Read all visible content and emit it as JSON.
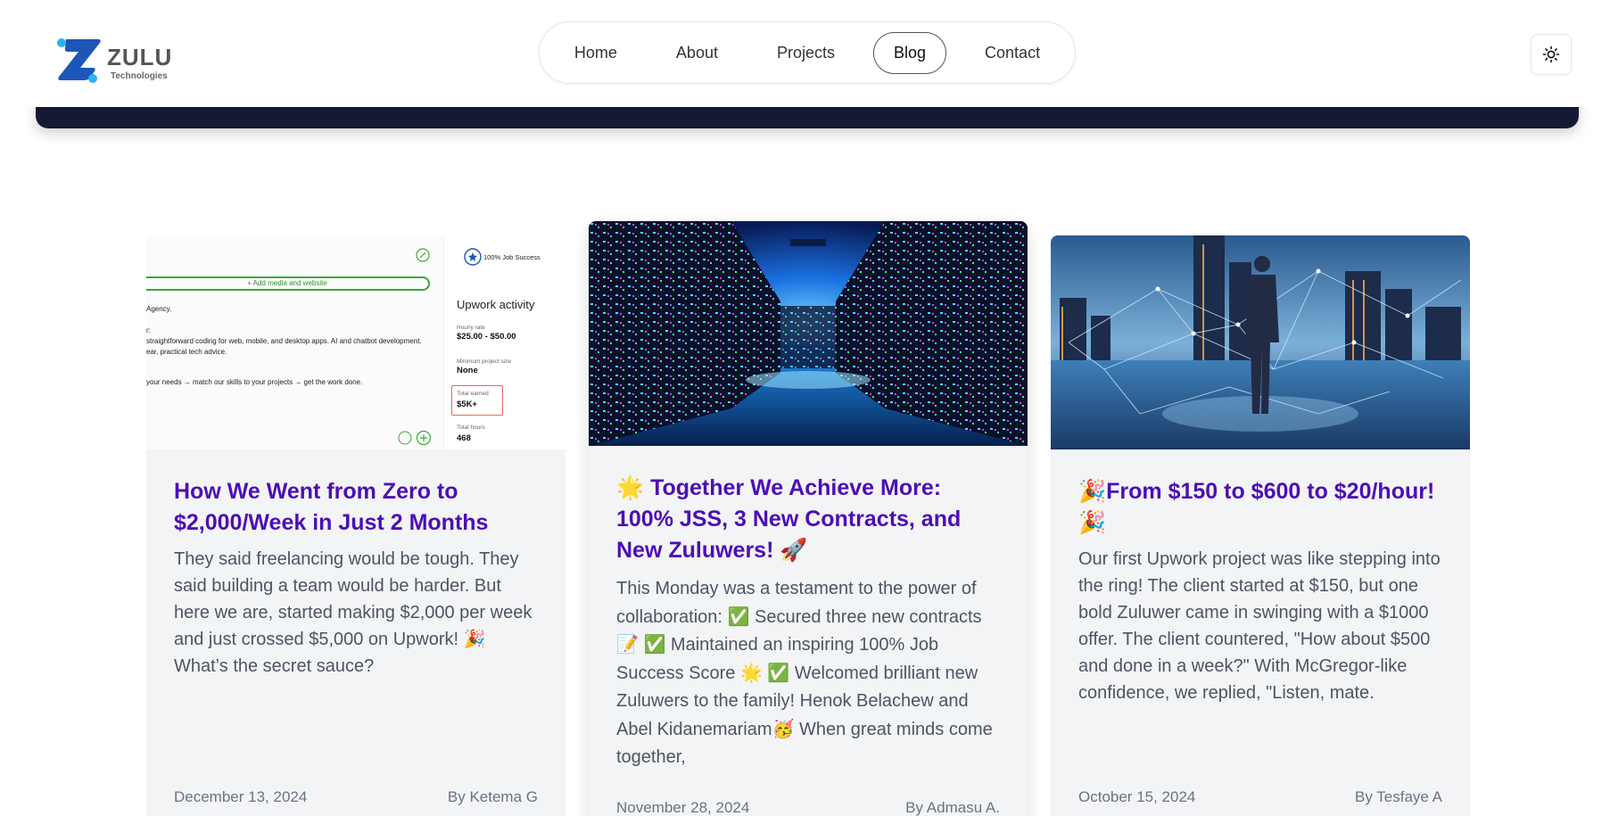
{
  "brand": {
    "name": "ZULU",
    "tagline": "Technologies",
    "primary_color": "#1e56b8",
    "accent_color": "#2bb3f0"
  },
  "nav": {
    "items": [
      {
        "label": "Home",
        "active": false
      },
      {
        "label": "About",
        "active": false
      },
      {
        "label": "Projects",
        "active": false
      },
      {
        "label": "Blog",
        "active": true
      },
      {
        "label": "Contact",
        "active": false
      }
    ]
  },
  "theme_toggle": {
    "icon": "sun-icon"
  },
  "posts": [
    {
      "title": "How We Went from Zero to $2,000/Week in Just 2 Months",
      "excerpt": "They said freelancing would be tough. They said building a team would be harder. But here we are, started making $2,000 per week and just crossed $5,000 on Upwork! 🎉 What’s the secret sauce?",
      "date": "December 13, 2024",
      "author": "By Ketema G",
      "image": {
        "kind": "upwork-profile-screenshot",
        "add_media": "+ Add media and website",
        "text_lines": [
          "Agency.",
          "r:",
          "straightforward coding for web, mobile, and desktop apps. AI and chatbot development.",
          "ear, practical tech advice.",
          "your needs → match our skills to your projects → get the work done."
        ],
        "job_success": "100% Job Success",
        "activity_title": "Upwork activity",
        "stats": [
          {
            "label": "Hourly rate",
            "value": "$25.00 - $50.00"
          },
          {
            "label": "Minimum project size",
            "value": "None"
          },
          {
            "label": "Total earned",
            "value": "$5K+"
          },
          {
            "label": "Total hours",
            "value": "468"
          }
        ]
      }
    },
    {
      "title": "🌟 Together We Achieve More: 100% JSS, 3 New Contracts, and New Zuluwers! 🚀",
      "excerpt": "This Monday was a testament to the power of collaboration: ✅ Secured three new contracts 📝 ✅ Maintained an inspiring 100% Job Success Score 🌟 ✅ Welcomed brilliant new Zuluwers to the family! Henok Belachew and Abel Kidanemariam🥳 When great minds come together,",
      "date": "November 28, 2024",
      "author": "By Admasu A.",
      "image": {
        "kind": "server-room-photo"
      }
    },
    {
      "title": "🎉From $150 to $600 to $20/hour! 🎉",
      "excerpt": "Our first Upwork project was like stepping into the ring! The client started at $150, but one bold Zuluwer came in swinging with a $1000 offer. The client countered, \"How about $500 and done in a week?\" With McGregor-like confidence, we replied, \"Listen, mate.",
      "date": "October 15, 2024",
      "author": "By Tesfaye A",
      "image": {
        "kind": "city-network-photo"
      }
    }
  ]
}
